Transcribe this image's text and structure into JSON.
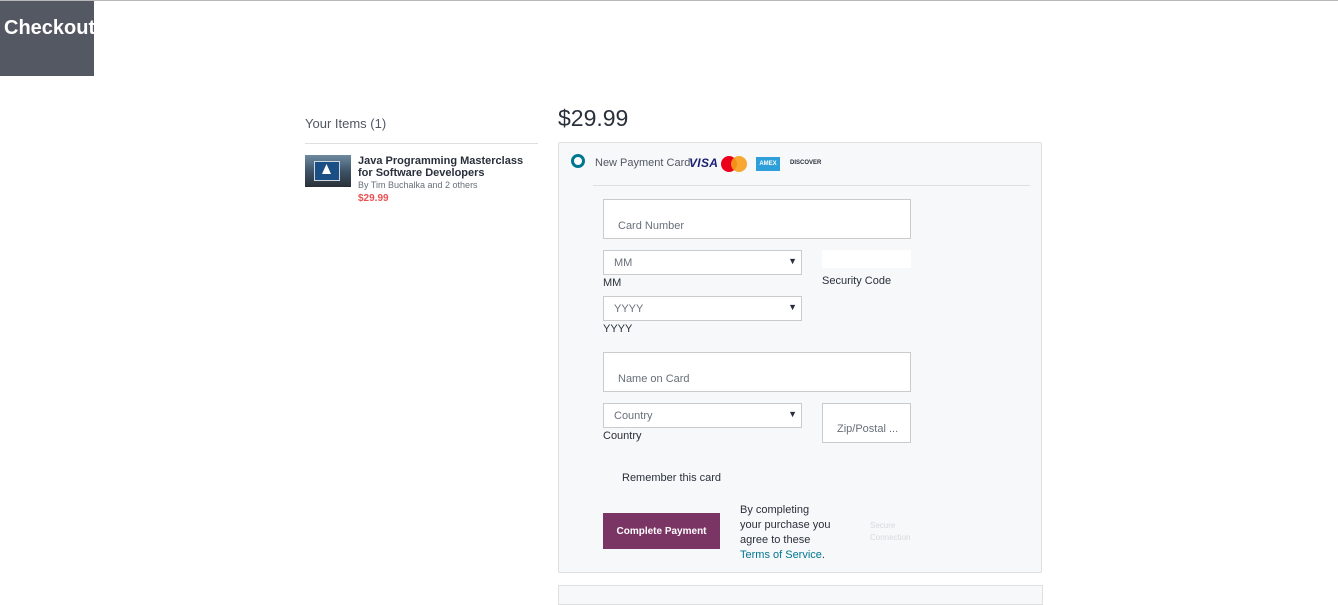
{
  "header": {
    "title": "Checkout"
  },
  "cart": {
    "heading": "Your Items (1)",
    "items": [
      {
        "title": "Java Programming Masterclass for Software Developers",
        "author": "By Tim Buchalka and 2 others",
        "price": "$29.99"
      }
    ]
  },
  "payment": {
    "total": "$29.99",
    "method_label": "New Payment Card",
    "card_logos": {
      "visa": "VISA",
      "amex": "AMEX",
      "discover": "DISCOVER"
    },
    "card_number_placeholder": "Card Number",
    "month": {
      "value": "MM",
      "label": "MM"
    },
    "year": {
      "value": "YYYY",
      "label": "YYYY"
    },
    "security_code_label": "Security Code",
    "name_placeholder": "Name on Card",
    "country": {
      "value": "Country",
      "label": "Country"
    },
    "zip_placeholder": "Zip/Postal ...",
    "remember_label": "Remember this card",
    "submit_label": "Complete Payment",
    "terms_text": "By completing your purchase you agree to these ",
    "terms_link": "Terms of Service",
    "terms_end": ".",
    "secure_text": "Secure Connection"
  },
  "colors": {
    "accent": "#7b3565",
    "link": "#007791",
    "price": "#ec5252",
    "header_bg": "#535862"
  }
}
